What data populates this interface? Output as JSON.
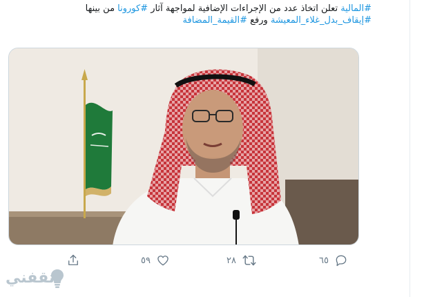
{
  "tweet": {
    "line1": {
      "tag_finance": "#المالية",
      "text_a": " تعلن اتخاذ عدد من الإجراءات الإضافية لمواجهة آثار ",
      "tag_corona": "#كورونا",
      "text_b": " من بينها"
    },
    "line2": {
      "tag_allowance": "#إيقاف_بدل_غلاء_المعيشة",
      "text_a": " ورفع ",
      "tag_vat": "#القيمة_المضافة"
    }
  },
  "actions": {
    "reply_count": "٦٥",
    "retweet_count": "٢٨",
    "like_count": "٥٩"
  },
  "watermark": {
    "text": "ثقفني"
  },
  "colors": {
    "hashtag": "#1b95e0",
    "icon_gray": "#657786",
    "flag_green": "#1f7a3a"
  }
}
